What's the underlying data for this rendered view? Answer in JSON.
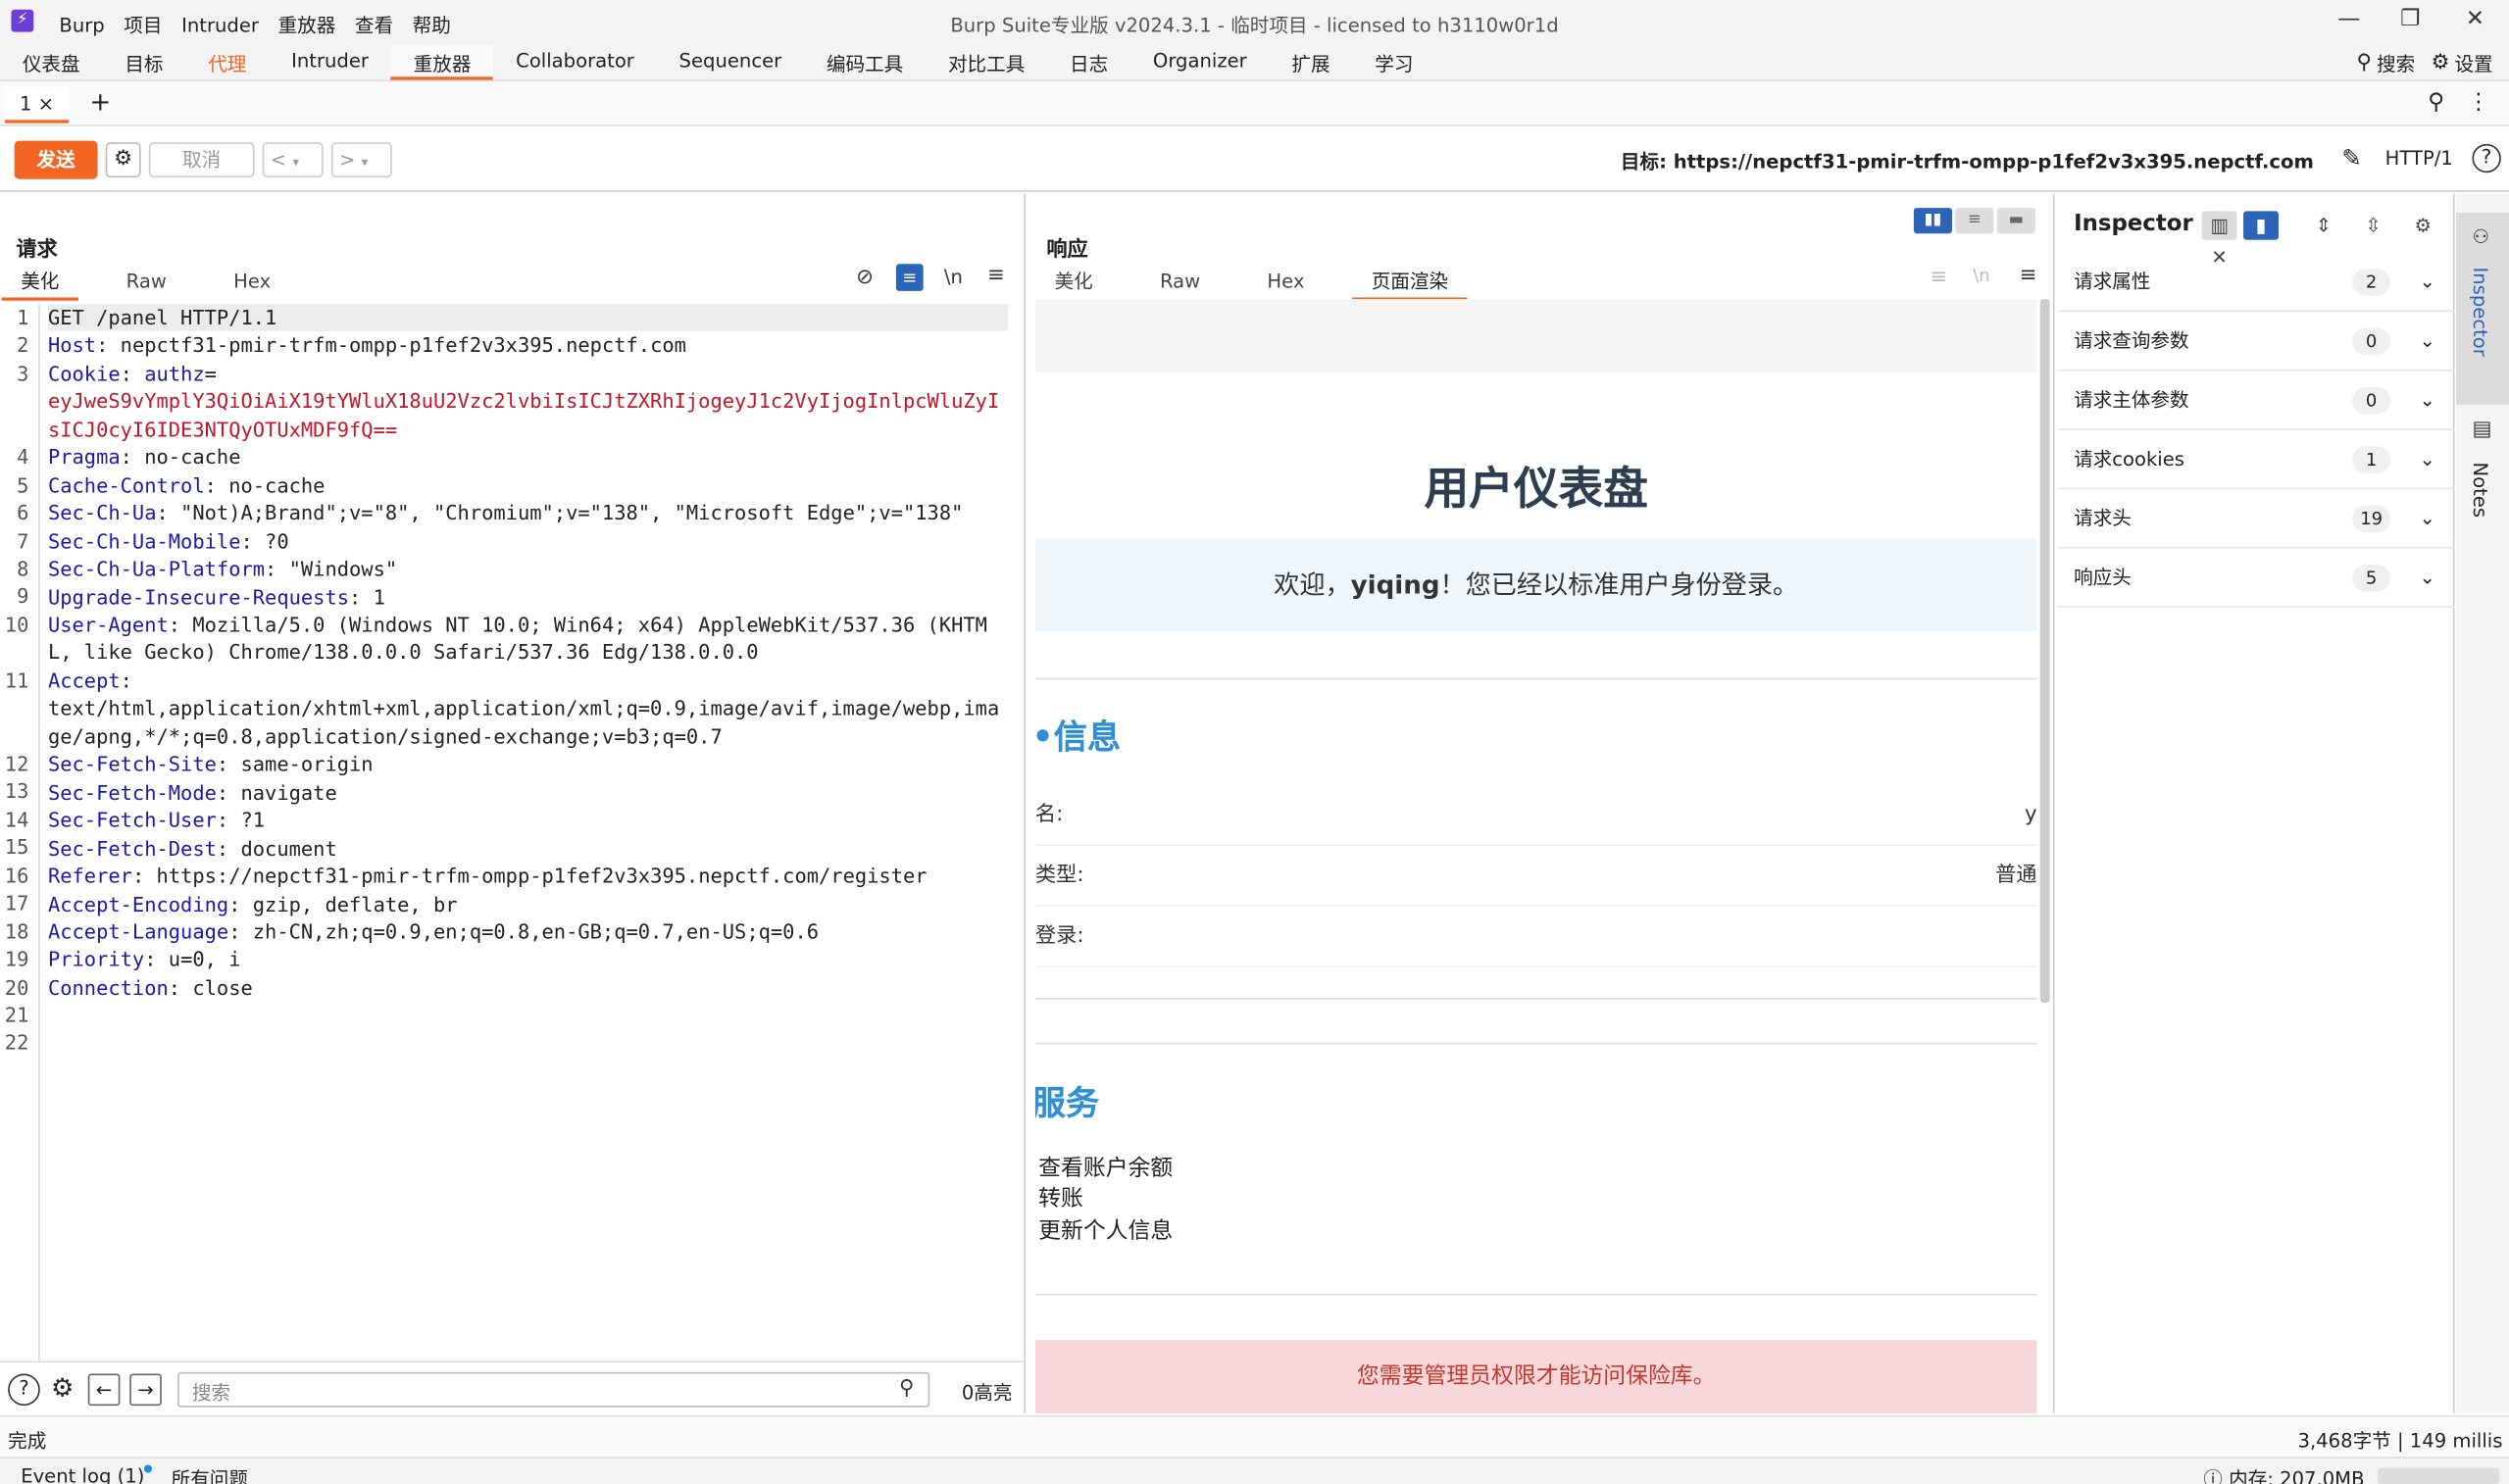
{
  "app": {
    "window_title": "Burp Suite专业版  v2024.3.1 - 临时项目 - licensed to h3110w0r1d",
    "menus": [
      "Burp",
      "项目",
      "Intruder",
      "重放器",
      "查看",
      "帮助"
    ],
    "window_controls": [
      "—",
      "❐",
      "✕"
    ]
  },
  "tools": {
    "items": [
      "仪表盘",
      "目标",
      "代理",
      "Intruder",
      "重放器",
      "Collaborator",
      "Sequencer",
      "编码工具",
      "对比工具",
      "日志",
      "Organizer",
      "扩展",
      "学习"
    ],
    "active": "重放器",
    "search_label": "搜索",
    "settings_label": "设置"
  },
  "tabs": {
    "tab1": "1 ×",
    "add": "+"
  },
  "actions": {
    "send": "发送",
    "cancel": "取消",
    "back": "<",
    "forward": ">",
    "target": "目标: https://nepctf31-pmir-trfm-ompp-p1fef2v3x395.nepctf.com",
    "http_version": "HTTP/1",
    "help": "?"
  },
  "request": {
    "title": "请求",
    "subtabs": [
      "美化",
      "Raw",
      "Hex"
    ],
    "line_numbers": [
      "1",
      "2",
      "3",
      "",
      "",
      "4",
      "5",
      "6",
      "7",
      "8",
      "9",
      "10",
      "",
      "11",
      "",
      "",
      "12",
      "13",
      "14",
      "15",
      "16",
      "17",
      "18",
      "19",
      "20",
      "21",
      "22"
    ],
    "lines": [
      {
        "k": "GET /panel HTTP/1.1",
        "v": ""
      },
      {
        "k": "Host",
        "v": ": nepctf31-pmir-trfm-ompp-p1fef2v3x395.nepctf.com"
      },
      {
        "k": "Cookie",
        "v": ": ",
        "k2": "authz",
        "v2": "="
      },
      {
        "red": "eyJweS9vYmplY3QiOiAiX19tYWluX18uU2Vzc2lvbiIsICJtZXRhIjogeyJ1c2VyIjogInlpcWluZyIsICJ0cyI6IDE3NTQyOTUxMDF9fQ=="
      },
      {
        "k": "Pragma",
        "v": ": no-cache"
      },
      {
        "k": "Cache-Control",
        "v": ": no-cache"
      },
      {
        "k": "Sec-Ch-Ua",
        "v": ": \"Not)A;Brand\";v=\"8\", \"Chromium\";v=\"138\", \"Microsoft Edge\";v=\"138\""
      },
      {
        "k": "Sec-Ch-Ua-Mobile",
        "v": ": ?0"
      },
      {
        "k": "Sec-Ch-Ua-Platform",
        "v": ": \"Windows\""
      },
      {
        "k": "Upgrade-Insecure-Requests",
        "v": ": 1"
      },
      {
        "k": "User-Agent",
        "v": ": Mozilla/5.0 (Windows NT 10.0; Win64; x64) AppleWebKit/537.36 (KHTML, like Gecko) Chrome/138.0.0.0 Safari/537.36 Edg/138.0.0.0"
      },
      {
        "k": "Accept",
        "v": ":"
      },
      {
        "plain": "text/html,application/xhtml+xml,application/xml;q=0.9,image/avif,image/webp,image/apng,*/*;q=0.8,application/signed-exchange;v=b3;q=0.7"
      },
      {
        "k": "Sec-Fetch-Site",
        "v": ": same-origin"
      },
      {
        "k": "Sec-Fetch-Mode",
        "v": ": navigate"
      },
      {
        "k": "Sec-Fetch-User",
        "v": ": ?1"
      },
      {
        "k": "Sec-Fetch-Dest",
        "v": ": document"
      },
      {
        "k": "Referer",
        "v": ": https://nepctf31-pmir-trfm-ompp-p1fef2v3x395.nepctf.com/register"
      },
      {
        "k": "Accept-Encoding",
        "v": ": gzip, deflate, br"
      },
      {
        "k": "Accept-Language",
        "v": ": zh-CN,zh;q=0.9,en;q=0.8,en-GB;q=0.7,en-US;q=0.6"
      },
      {
        "k": "Priority",
        "v": ": u=0, i"
      },
      {
        "k": "Connection",
        "v": ": close"
      },
      {
        "plain": ""
      },
      {
        "plain": ""
      }
    ],
    "search_placeholder": "搜索",
    "highlight_count": "0高亮"
  },
  "response": {
    "title": "响应",
    "subtabs": [
      "美化",
      "Raw",
      "Hex",
      "页面渲染"
    ],
    "active_subtab": "页面渲染",
    "page": {
      "heading": "用户仪表盘",
      "welcome_pre": "欢迎，",
      "welcome_user": "yiqing",
      "welcome_post": "！您已经以标准用户身份登录。",
      "info_title": "信息",
      "info_title_prefix": "•",
      "info_rows": [
        {
          "label": "名:",
          "value": "y"
        },
        {
          "label": "类型:",
          "value": "普通"
        },
        {
          "label": "登录:",
          "value": ""
        }
      ],
      "services_title": "服务",
      "services": [
        "查看账户余额",
        "转账",
        "更新个人信息"
      ],
      "alert": "您需要管理员权限才能访问保险库。"
    }
  },
  "inspector": {
    "title": "Inspector",
    "sections": [
      {
        "label": "请求属性",
        "count": "2"
      },
      {
        "label": "请求查询参数",
        "count": "0"
      },
      {
        "label": "请求主体参数",
        "count": "0"
      },
      {
        "label": "请求cookies",
        "count": "1"
      },
      {
        "label": "请求头",
        "count": "19"
      },
      {
        "label": "响应头",
        "count": "5"
      }
    ]
  },
  "sidebar": {
    "inspector": "Inspector",
    "notes": "Notes"
  },
  "status": {
    "left": "完成",
    "right": "3,468字节 | 149 millis"
  },
  "bottom": {
    "event_log": "Event log (1)",
    "issues": "所有问题",
    "memory": "内存: 207.0MB"
  },
  "colors": {
    "accent": "#f26522",
    "header_key": "#1a1aa6",
    "cookie_value": "#c0172b",
    "section_blue": "#2e8fd5",
    "alert_bg": "#f8d7da"
  }
}
